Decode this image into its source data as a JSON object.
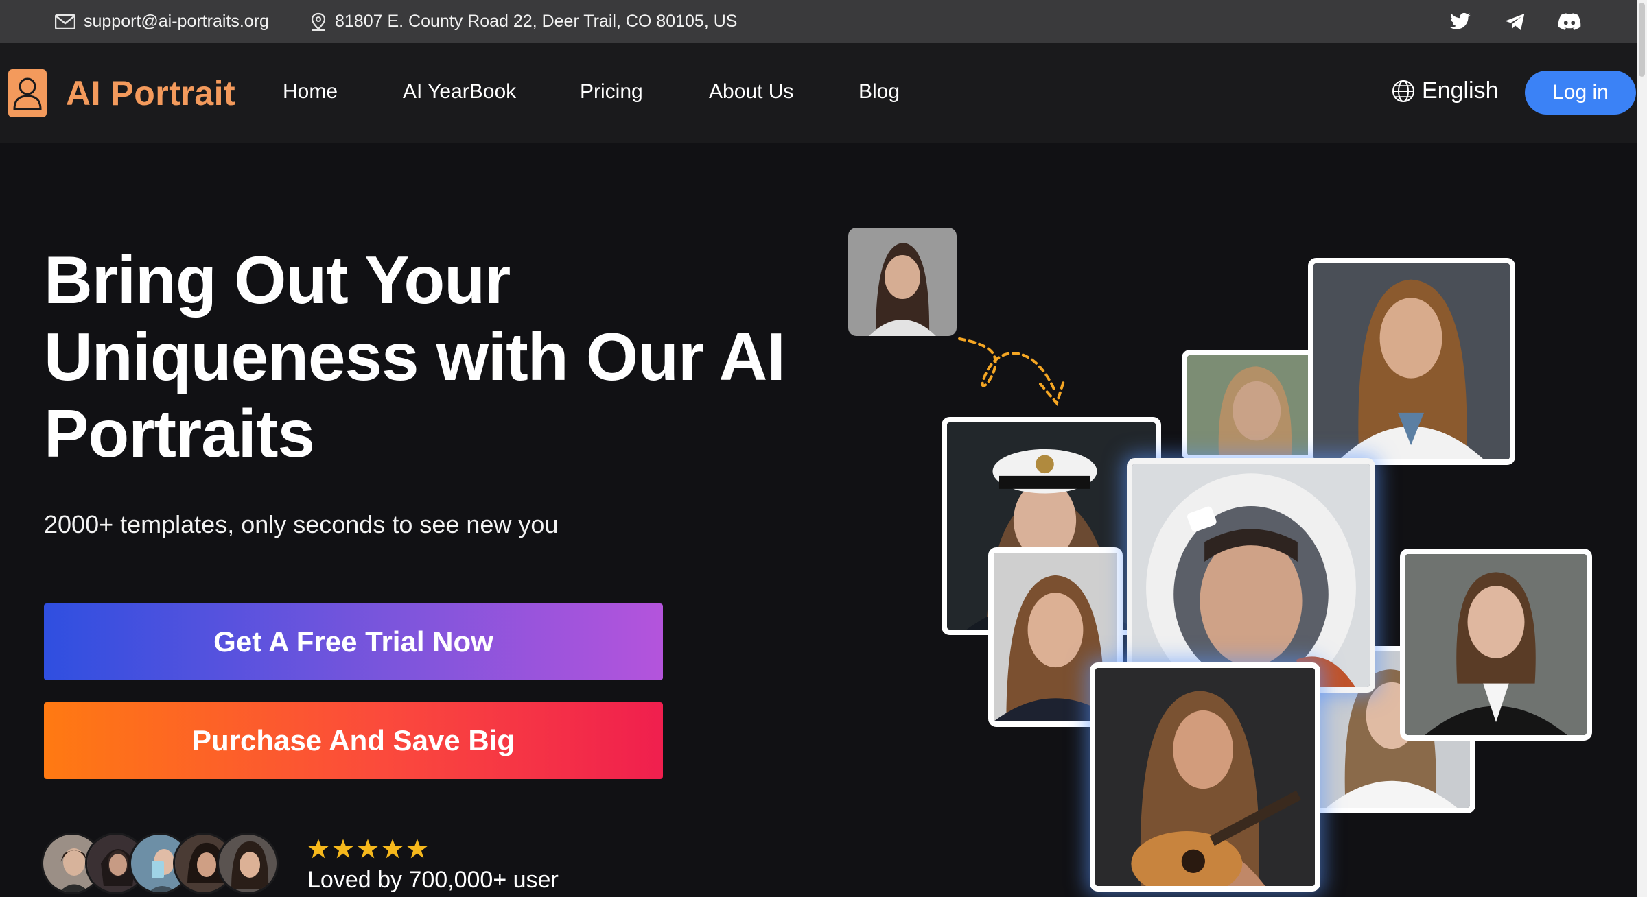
{
  "topbar": {
    "email": "support@ai-portraits.org",
    "address": "81807 E. County Road 22, Deer Trail, CO 80105, US",
    "social_icons": [
      "twitter-icon",
      "telegram-icon",
      "discord-icon"
    ]
  },
  "header": {
    "brand": "AI Portrait",
    "nav": {
      "home": "Home",
      "yearbook": "AI YearBook",
      "pricing": "Pricing",
      "about": "About Us",
      "blog": "Blog"
    },
    "language": "English",
    "login": "Log in"
  },
  "hero": {
    "headline": "Bring Out Your Uniqueness with Our AI Portraits",
    "subline": "2000+ templates, only seconds to see new you",
    "cta_trial": "Get A Free Trial Now",
    "cta_buy": "Purchase And Save Big",
    "rating_stars": 5,
    "loved": "Loved by 700,000+ user"
  },
  "colors": {
    "brand": "#f39a5c",
    "login_button": "#3b82f6",
    "trial_gradient": [
      "#2f4fe0",
      "#b454dc"
    ],
    "buy_gradient": [
      "#ff7a12",
      "#f01f4e"
    ],
    "star": "#f6b81c",
    "arrow": "#f5a623"
  }
}
